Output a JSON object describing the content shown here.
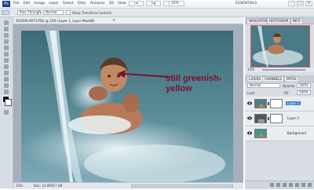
{
  "app": {
    "logo": "Ps",
    "menu": [
      "File",
      "Edit",
      "Image",
      "Layer",
      "Select",
      "Filter",
      "Analysis",
      "3D",
      "View",
      "Window",
      "Help"
    ],
    "zoom": "33%",
    "workspace": "ESSENTIALS"
  },
  "options_bar": {
    "mode_value": "Pass Through",
    "mode_field": "Normal",
    "checkbox_label": "Show Transform Controls"
  },
  "document": {
    "tab_label": "SR2009-0073.PSD @ 33% (Layer 1, Layer Mask/8)",
    "status_zoom": "33%",
    "status_doc": "Doc: 23.6M/47.2M"
  },
  "annotation": {
    "text": "still greenish-yellow"
  },
  "navigator": {
    "tabs": [
      "NAVIGATOR",
      "HISTOGRAM",
      "INFO"
    ],
    "zoom": "33%"
  },
  "layers_panel": {
    "tabs": [
      "LAYERS",
      "CHANNELS",
      "PATHS"
    ],
    "blend_mode": "Normal",
    "opacity_label": "Opacity:",
    "opacity": "100%",
    "lock_label": "Lock:",
    "fill_label": "Fill:",
    "fill": "100%",
    "layers": [
      {
        "name": "Layer 1",
        "selected": true
      },
      {
        "name": "Layer 2",
        "selected": false
      },
      {
        "name": "Background",
        "selected": false
      }
    ]
  },
  "colors": {
    "annotation": "#7a1030",
    "selection": "#3d7fd8",
    "navigator_box": "#d8586c"
  }
}
